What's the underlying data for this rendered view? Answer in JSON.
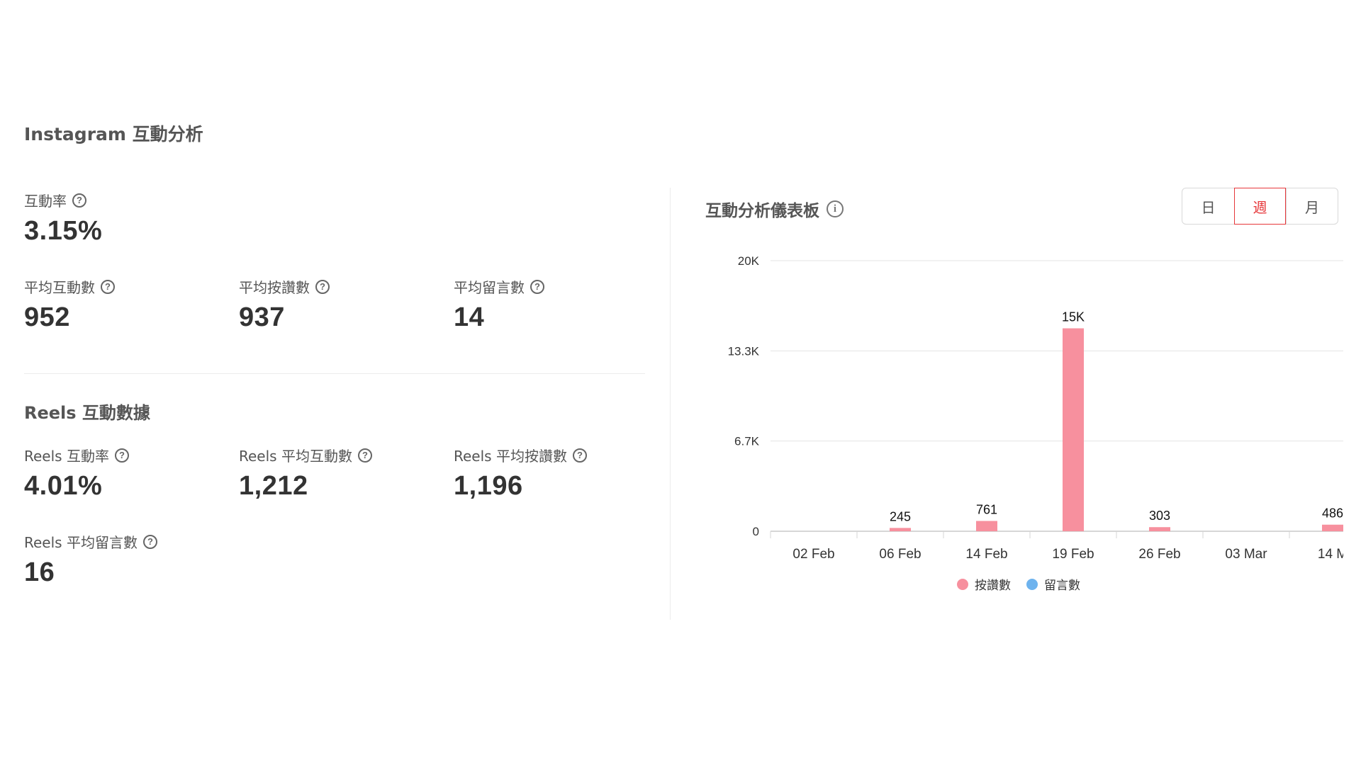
{
  "page": {
    "title": "Instagram 互動分析"
  },
  "overview": {
    "engagement_rate": {
      "label": "互動率",
      "value": "3.15%"
    },
    "avg_engagement": {
      "label": "平均互動數",
      "value": "952"
    },
    "avg_likes": {
      "label": "平均按讚數",
      "value": "937"
    },
    "avg_comments": {
      "label": "平均留言數",
      "value": "14"
    }
  },
  "reels": {
    "title": "Reels 互動數據",
    "engagement_rate": {
      "label": "Reels 互動率",
      "value": "4.01%"
    },
    "avg_engagement": {
      "label": "Reels 平均互動數",
      "value": "1,212"
    },
    "avg_likes": {
      "label": "Reels 平均按讚數",
      "value": "1,196"
    },
    "avg_comments": {
      "label": "Reels 平均留言數",
      "value": "16"
    }
  },
  "help_glyph": "?",
  "info_glyph": "i",
  "dashboard": {
    "title": "互動分析儀表板",
    "period_buttons": [
      "日",
      "週",
      "月"
    ],
    "active_period": "週"
  },
  "colors": {
    "likes": "#f7909e",
    "comments": "#6eb3ee",
    "accent": "#e6373a"
  },
  "chart_data": {
    "type": "bar",
    "categories": [
      "02 Feb",
      "06 Feb",
      "14 Feb",
      "19 Feb",
      "26 Feb",
      "03 Mar",
      "14 M"
    ],
    "series": [
      {
        "name": "按讚數",
        "values": [
          null,
          245,
          761,
          15000,
          303,
          null,
          486
        ],
        "labels": [
          "",
          "245",
          "761",
          "15K",
          "303",
          "",
          "486"
        ]
      },
      {
        "name": "留言數",
        "values": [
          null,
          null,
          null,
          null,
          null,
          null,
          null
        ]
      }
    ],
    "y_ticks": [
      "0",
      "6.7K",
      "13.3K",
      "20K"
    ],
    "ylim": [
      0,
      20000
    ],
    "grid": true,
    "legend": "bottom"
  }
}
